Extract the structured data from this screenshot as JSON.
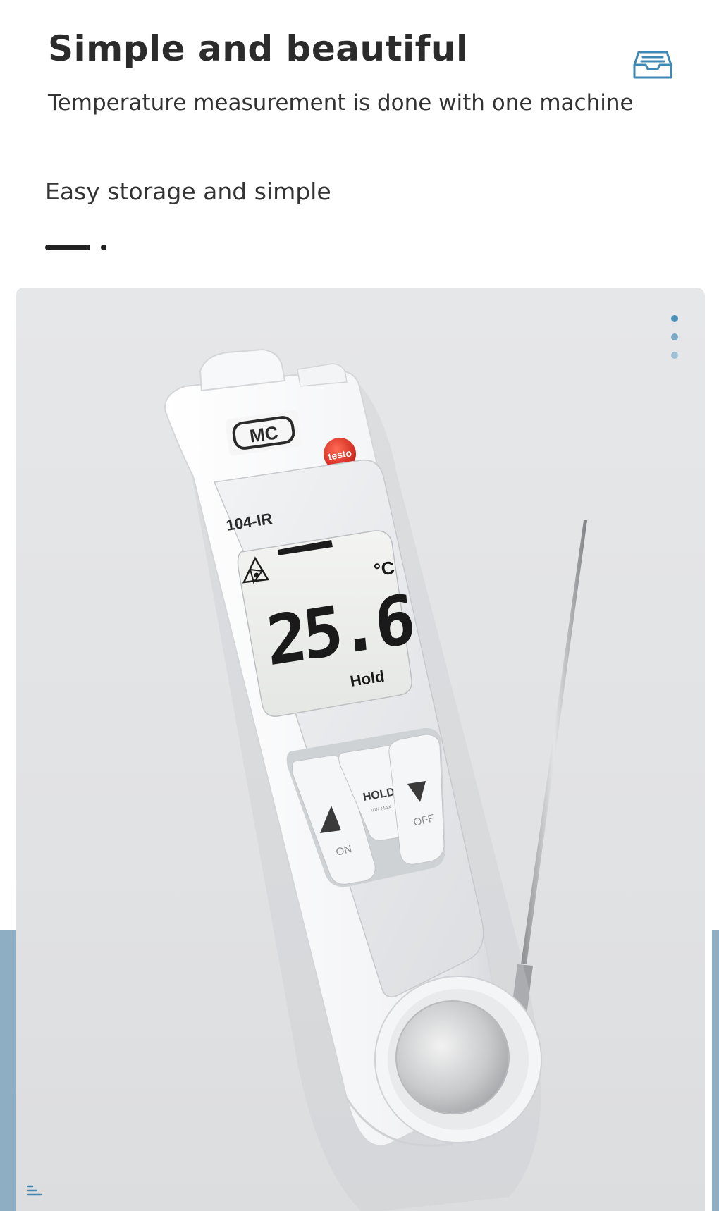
{
  "header": {
    "title": "Simple and beautiful",
    "subtitle": "Temperature measurement is done with one machine",
    "tagline": "Easy storage and simple"
  },
  "icons": {
    "top_right": "storage-tray-icon",
    "bottom_left": "menu-icon"
  },
  "device": {
    "brand_badge": "MC",
    "brand_logo": "testo",
    "model": "104-IR",
    "display_value": "25.6",
    "display_unit": "°C",
    "display_status": "Hold",
    "button_center": "HOLD",
    "button_center_sub": "MIN MAX",
    "button_left": "ON",
    "button_right": "OFF"
  },
  "carousel": {
    "slide_count": 3,
    "active_index": 0
  },
  "colors": {
    "accent": "#4a90b8",
    "accent_light": "#9ec1d6",
    "side_band": "#8eaec4",
    "text_dark": "#2b2b2b"
  }
}
